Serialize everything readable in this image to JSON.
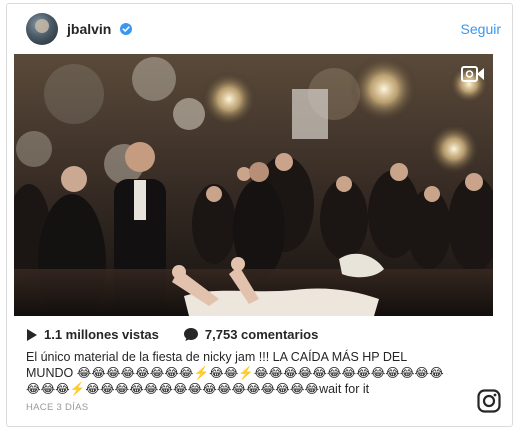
{
  "header": {
    "username": "jbalvin",
    "follow_label": "Seguir",
    "avatar_icon": "avatar-photo",
    "verified_icon": "verified-badge-icon"
  },
  "media": {
    "video_icon": "video-camera-icon"
  },
  "stats": {
    "views": "1.1 millones vistas",
    "comments": "7,753 comentarios",
    "play_icon": "play-icon",
    "comment_icon": "comment-bubble-icon"
  },
  "caption": "El único material de la fiesta de nicky jam !!! LA CAÍDA MÁS HP DEL MUNDO 😂😂😂😂😂😂😂😂⚡️😂😂⚡️😂😂😂😂😂😂😂😂😂😂😂😂😂😂😂😂⚡️😂😂😂😂😂😂😂😂😂😂😂😂😂😂😂😂wait for it",
  "timestamp": "HACE 3 DÍAS",
  "footer": {
    "logo_icon": "instagram-logo-icon"
  },
  "colors": {
    "link": "#3897f0",
    "text": "#262626",
    "muted": "#999999",
    "border": "#dbdbdb"
  }
}
